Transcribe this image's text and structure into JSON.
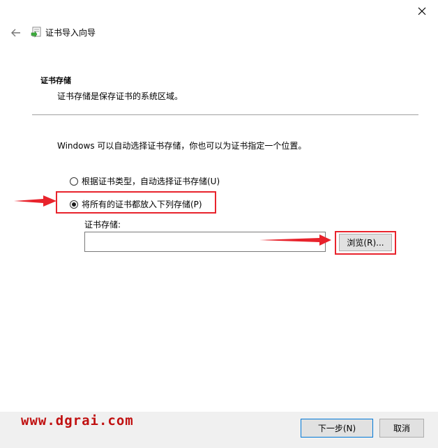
{
  "titlebar": {
    "close_icon": "close-icon"
  },
  "header": {
    "back_icon": "back-arrow-icon",
    "wizard_icon": "certificate-icon",
    "title": "证书导入向导"
  },
  "section": {
    "title": "证书存储",
    "description": "证书存储是保存证书的系统区域。"
  },
  "intro_text": "Windows 可以自动选择证书存储，你也可以为证书指定一个位置。",
  "options": [
    {
      "label": "根据证书类型，自动选择证书存储(U)",
      "checked": false
    },
    {
      "label": "将所有的证书都放入下列存储(P)",
      "checked": true
    }
  ],
  "store": {
    "label": "证书存储:",
    "value": "",
    "browse_label": "浏览(R)..."
  },
  "watermark": "www.dgrai.com",
  "footer": {
    "next_label": "下一步(N)",
    "cancel_label": "取消"
  },
  "colors": {
    "highlight": "#e8232c",
    "footer_bg": "#f0f0f0",
    "button_bg": "#e1e1e1",
    "accent": "#0078d7"
  }
}
